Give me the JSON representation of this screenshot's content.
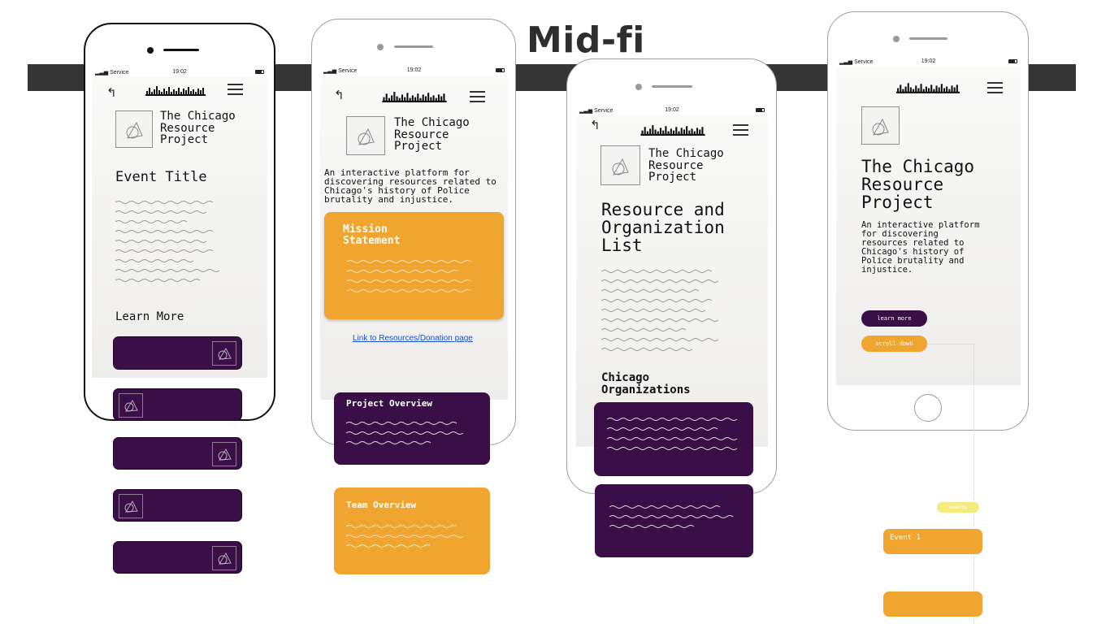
{
  "heading": "Mid-fi",
  "status": {
    "carrier": "Service",
    "time": "19:02"
  },
  "screen1": {
    "brand": [
      "The Chicago",
      "Resource",
      "Project"
    ],
    "event_title": "Event Title",
    "learn_more": "Learn More"
  },
  "screen2": {
    "brand": [
      "The Chicago",
      "Resource",
      "Project"
    ],
    "intro": [
      "An interactive platform for",
      "discovering resources related to",
      "Chicago's history of Police",
      "brutality and injustice."
    ],
    "mission_title": [
      "Mission",
      "Statement"
    ],
    "link": "Link to Resources/Donation page",
    "project_overview": "Project Overview",
    "team_overview": "Team Overview"
  },
  "screen3": {
    "brand": [
      "The Chicago",
      "Resource",
      "Project"
    ],
    "list_title": [
      "Resource and",
      "Organization",
      "List"
    ],
    "orgs_title": [
      "Chicago",
      "Organizations"
    ]
  },
  "screen4": {
    "brand": [
      "The Chicago",
      "Resource",
      "Project"
    ],
    "intro": [
      "An interactive platform",
      "for discovering",
      "resources related to",
      "Chicago's history of",
      "Police brutality and",
      "injustice."
    ],
    "learn_more_btn": "learn more",
    "scroll_down_btn": "scroll down",
    "events_label": "events",
    "event1": "Event 1"
  },
  "colors": {
    "purple": "#3a0f47",
    "orange": "#efa530",
    "band": "#353535",
    "link": "#1a4fcf"
  },
  "icons": [
    "back-arrow-icon",
    "skyline-logo-icon",
    "hamburger-menu-icon",
    "geometric-placeholder-icon"
  ]
}
